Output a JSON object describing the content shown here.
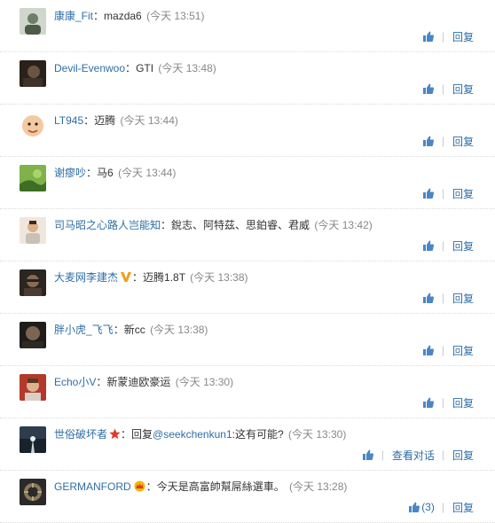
{
  "comments": [
    {
      "user": "康康_Fit",
      "text": "mazda6",
      "time": "(今天 13:51)",
      "reply": "回复",
      "avatar_color": "#6f7d6a"
    },
    {
      "user": "Devil-Evenwoo",
      "text": "GTI",
      "time": "(今天 13:48)",
      "reply": "回复",
      "avatar_color": "#4a3a2e"
    },
    {
      "user": "LT945",
      "text": "迈腾",
      "time": "(今天 13:44)",
      "reply": "回复",
      "avatar_color": "#f3c9a0"
    },
    {
      "user": "谢瘳吵",
      "text": "马6",
      "time": "(今天 13:44)",
      "reply": "回复",
      "avatar_color": "#4f8a2f"
    },
    {
      "user": "司马昭之心路人岂能知",
      "text": "銳志、阿特茲、思鉑睿、君威",
      "time": "(今天 13:42)",
      "reply": "回复",
      "avatar_color": "#d9c7b4"
    },
    {
      "user": "大麦网李建杰",
      "text": "迈腾1.8T",
      "time": "(今天 13:38)",
      "reply": "回复",
      "avatar_color": "#5a4a3e",
      "badge": "vip-v"
    },
    {
      "user": "胖小虎_飞飞",
      "text": "新cc",
      "time": "(今天 13:38)",
      "reply": "回复",
      "avatar_color": "#3b3733"
    },
    {
      "user": "Echo小V",
      "text": "新蒙迪欧豪运",
      "time": "(今天 13:30)",
      "reply": "回复",
      "avatar_color": "#b23a2c"
    },
    {
      "user": "世俗破坏者",
      "text_prefix": "回复",
      "mention": "@seekchenkun1",
      "text": ":这有可能?",
      "time": "(今天 13:30)",
      "view_dialog": "查看对话",
      "reply": "回复",
      "avatar_color": "#5d7080",
      "badge": "red-star"
    },
    {
      "user": "GERMANFORD",
      "text": "今天是高富帥幫屌絲選車。",
      "time": "(今天 13:28)",
      "like_count": "(3)",
      "reply": "回复",
      "avatar_color": "#3a3a3a",
      "badge": "gold-crown"
    }
  ],
  "colors": {
    "link": "#2e6ea7",
    "time": "#888888",
    "separator": "#c8c8c8"
  }
}
